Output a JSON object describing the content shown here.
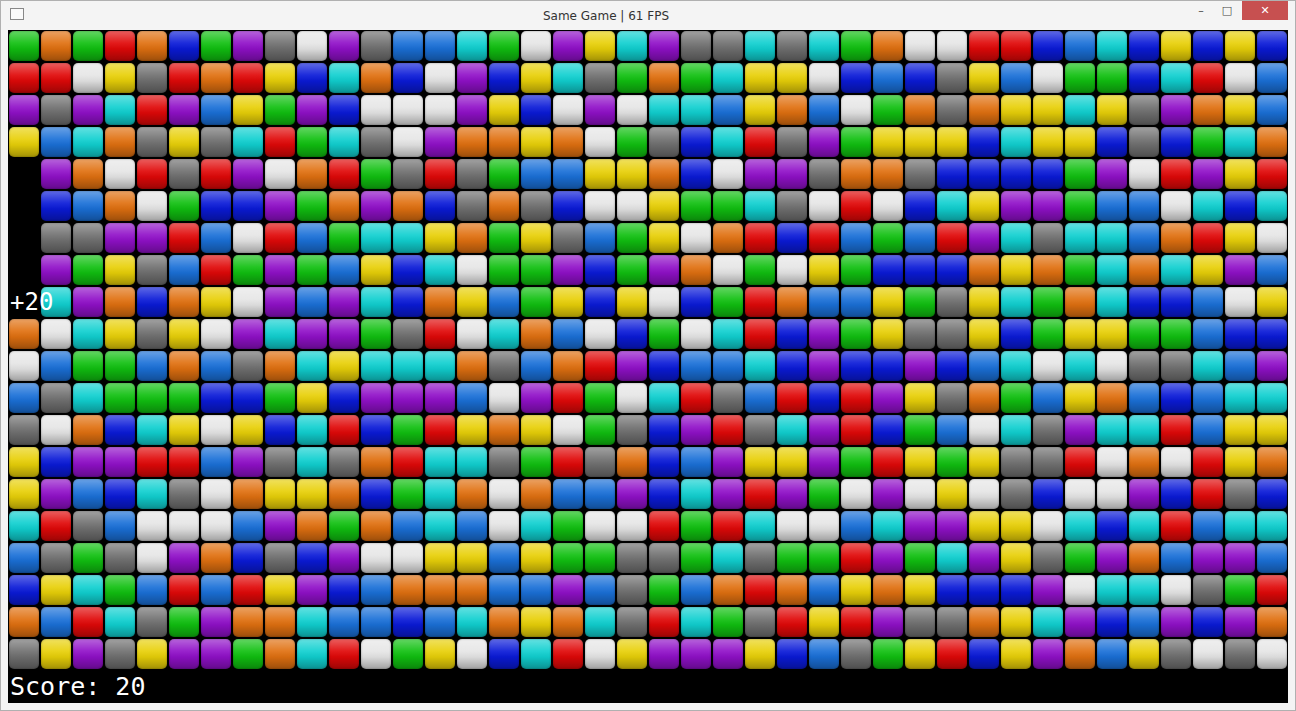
{
  "window": {
    "title": "Same Game | 61 FPS",
    "controls": [
      "–",
      "□",
      "✕"
    ]
  },
  "board": {
    "colors": {
      "G": "#10c010",
      "O": "#e07010",
      "R": "#e00808",
      "B": "#0a1ad8",
      "P": "#9010c8",
      "A": "#707070",
      "W": "#e6e6e6",
      "C": "#10d0d0",
      "Y": "#e8d008",
      "L": "#1a70d8"
    },
    "rows": [
      "GOGROBGPAWPALLCGWPYCPAACACGOWWRRBLCBYBYB",
      "RRWYARORYBCOBWPBYCAGOGCYYWBLBAYLWGGBCRWL",
      "PAPCRPLYGPBWWWPYBWPWCCLYOLWGOAOYYCYAPOYL",
      "YLCOAYACRGCAWPOOYOWGABCRAPGYYYBCYYBABGCO",
      ".POWRARPWORGARAGLLYYOBWPPAOOABBBBGPWRPYR",
      ".BLOWGBBPGOPOBAOABWWYGGCAWRWBCYPPGLLWCBC",
      ".AAPPRLWRLGCCYOGYALGYWORBRLGLRPCACCLORYW",
      ".PGYALRGPGLYBCWGGPBGPOWGWYGBBBOYOGCOCYPL",
      ".CPOBOYWPLPCBOYLGYBYWBGROLLYGAYCGOCBBLWY",
      "OWCYAYWPCPPGARWCOLWBGWCRBPGYAAYBGYYGGLBB",
      "WLGGLOLAOCYCCCOALORPBLLCBPBBPBLCWCWAACLP",
      "LACGGGBBGYBPPPLWPRGWCRALRBRPYAOGLYOLBLCC",
      "AWOBCYWYBCRBGRYOYWGABPRACPRBGLWCAPCCRLYY",
      "YBPPRRLPACAORCCAGRAOBLPYYPGRYGYAARWOWRYO",
      "YPLBCAWOYYOBGCOWOLLPBCPRPGWPWYWABWWPBRAB",
      "CRALWWWLPOGOLCLWCGWWRGRCWWLCPPYYWCBCRLCC",
      "LAGAWPOBABPWWYYLYGGAAGCAGGRPGCPYAGPOLPPL",
      "BYCGLRLRYPBLOOOLLPLAGLOROLYOYBBBPWCCWAGR",
      "OLRCAGPOOCLLBLCOYOCARCGARYRPAAOYCPBLPBPO",
      "AYPAYPPGOCRWGYWBCRWYPPPYBLAGYRBYPOLYAWAW"
    ]
  },
  "popup": {
    "text": "+20"
  },
  "status": {
    "score": "Score: 20"
  }
}
